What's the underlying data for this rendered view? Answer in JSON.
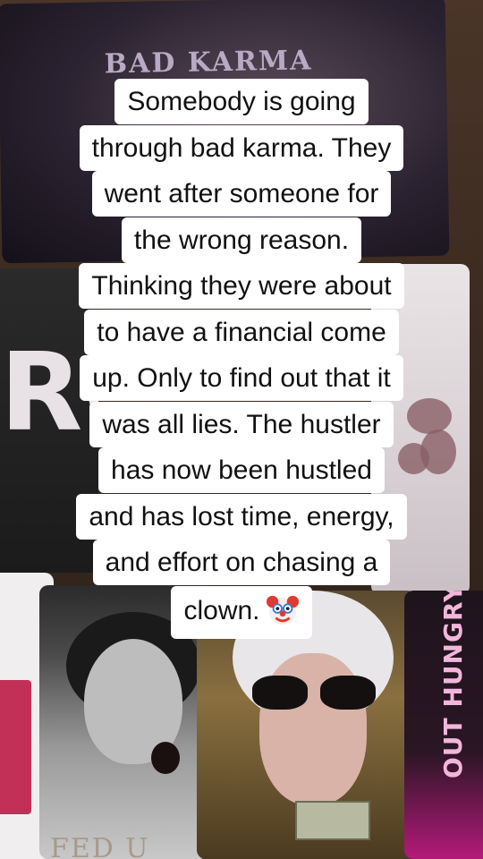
{
  "caption": {
    "lines": [
      "Somebody is going",
      "through bad karma. They",
      "went after someone for",
      "the wrong reason.",
      "Thinking they were about",
      "to have a financial come",
      "up. Only to find out that it",
      "was all lies. The hustler",
      "has now been hustled",
      "and has lost time, energy,",
      "and effort on chasing a",
      "clown."
    ],
    "emoji": "clown-face-icon"
  },
  "cards": {
    "top_title": "BAD KARMA",
    "left_partial": "RC",
    "woman_label": "FED U",
    "right_label": "OUT HUNGRY"
  }
}
